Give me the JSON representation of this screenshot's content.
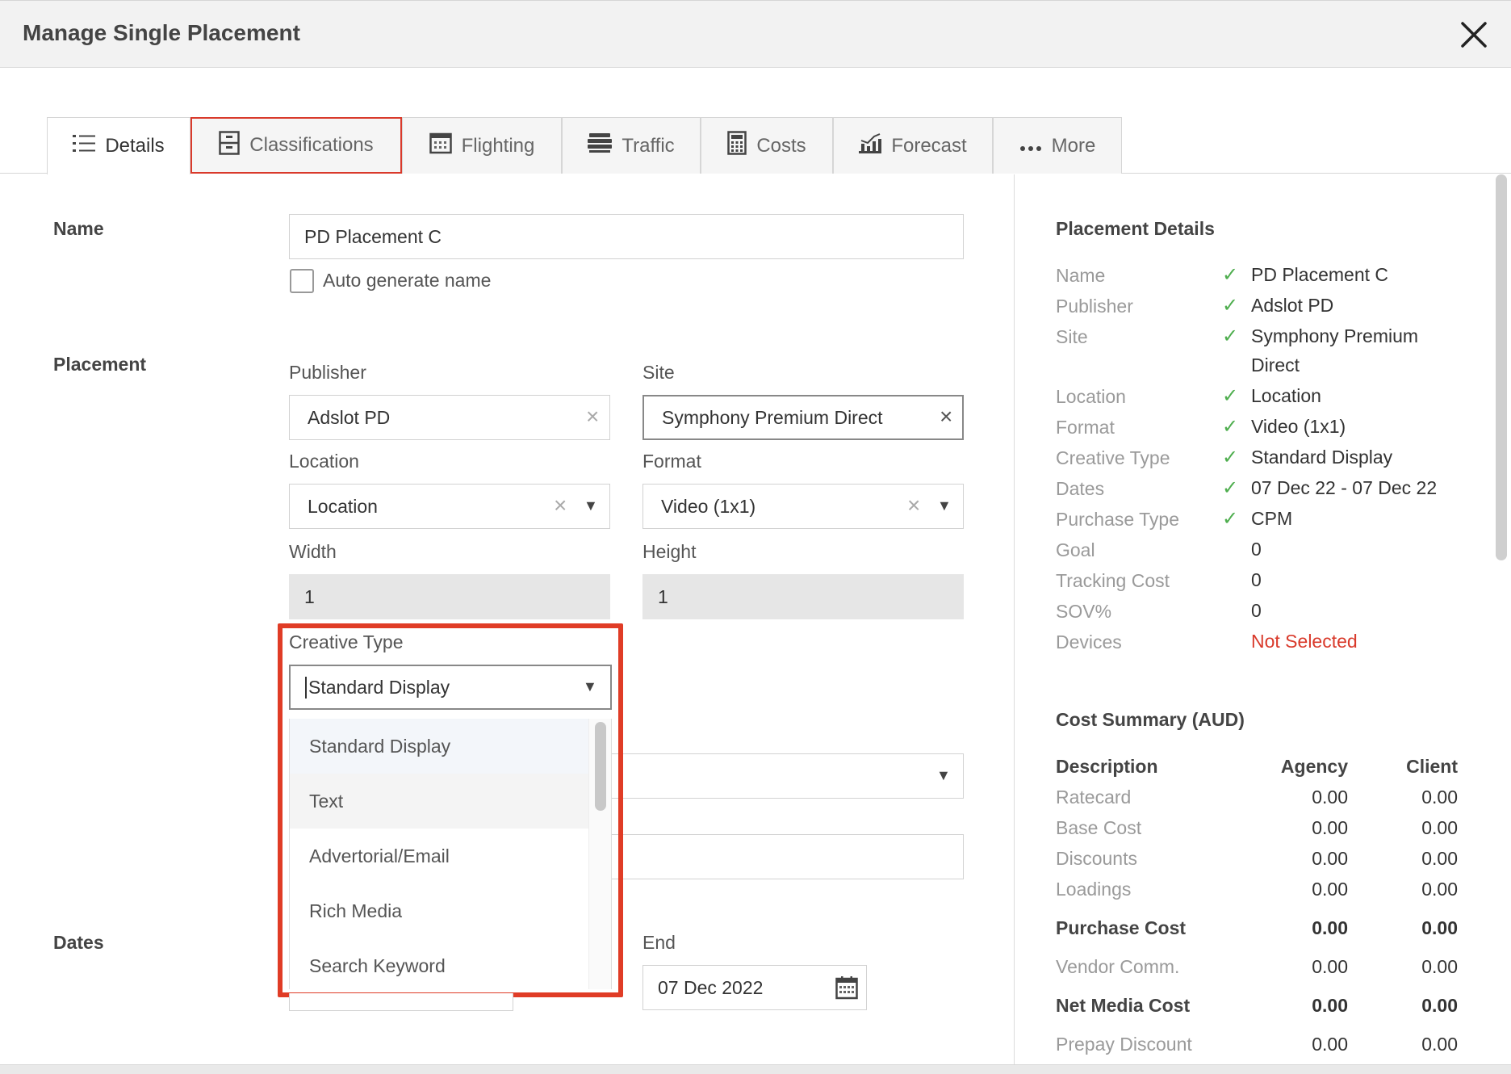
{
  "window": {
    "title": "Manage Single Placement"
  },
  "tabs": [
    {
      "label": "Details",
      "icon": "list-icon"
    },
    {
      "label": "Classifications",
      "icon": "cabinet-icon"
    },
    {
      "label": "Flighting",
      "icon": "calendar-icon"
    },
    {
      "label": "Traffic",
      "icon": "server-icon"
    },
    {
      "label": "Costs",
      "icon": "calculator-icon"
    },
    {
      "label": "Forecast",
      "icon": "chart-icon"
    },
    {
      "label": "More",
      "icon": "ellipsis-icon"
    }
  ],
  "form": {
    "name_section": "Name",
    "name_value": "PD Placement C",
    "auto_generate_label": "Auto generate name",
    "placement_section": "Placement",
    "publisher_label": "Publisher",
    "publisher_value": "Adslot PD",
    "site_label": "Site",
    "site_value": "Symphony Premium Direct",
    "location_label": "Location",
    "location_value": "Location",
    "format_label": "Format",
    "format_value": "Video (1x1)",
    "width_label": "Width",
    "width_value": "1",
    "height_label": "Height",
    "height_value": "1",
    "creative_type_label": "Creative Type",
    "creative_type_value": "Standard Display",
    "creative_type_options": [
      "Standard Display",
      "Text",
      "Advertorial/Email",
      "Rich Media",
      "Search Keyword"
    ],
    "dates_section": "Dates",
    "end_label": "End",
    "end_value": "07 Dec 2022"
  },
  "placement_details": {
    "title": "Placement Details",
    "rows": [
      {
        "label": "Name",
        "value": "PD Placement C",
        "check": "✓"
      },
      {
        "label": "Publisher",
        "value": "Adslot PD",
        "check": "✓"
      },
      {
        "label": "Site",
        "value": "Symphony Premium Direct",
        "check": "✓"
      },
      {
        "label": "Location",
        "value": "Location",
        "check": "✓"
      },
      {
        "label": "Format",
        "value": "Video (1x1)",
        "check": "✓"
      },
      {
        "label": "Creative Type",
        "value": "Standard Display",
        "check": "✓"
      },
      {
        "label": "Dates",
        "value": "07 Dec 22 - 07 Dec 22",
        "check": "✓"
      },
      {
        "label": "Purchase Type",
        "value": "CPM",
        "check": "✓"
      },
      {
        "label": "Goal",
        "value": "0",
        "check": ""
      },
      {
        "label": "Tracking Cost",
        "value": "0",
        "check": ""
      },
      {
        "label": "SOV%",
        "value": "0",
        "check": ""
      },
      {
        "label": "Devices",
        "value": "Not Selected",
        "check": ""
      }
    ]
  },
  "cost_summary": {
    "title": "Cost Summary (AUD)",
    "col_description": "Description",
    "col_agency": "Agency",
    "col_client": "Client",
    "rows": [
      {
        "label": "Ratecard",
        "agency": "0.00",
        "client": "0.00"
      },
      {
        "label": "Base Cost",
        "agency": "0.00",
        "client": "0.00"
      },
      {
        "label": "Discounts",
        "agency": "0.00",
        "client": "0.00"
      },
      {
        "label": "Loadings",
        "agency": "0.00",
        "client": "0.00"
      },
      {
        "label": "Purchase Cost",
        "agency": "0.00",
        "client": "0.00"
      },
      {
        "label": "Vendor Comm.",
        "agency": "0.00",
        "client": "0.00"
      },
      {
        "label": "Net Media Cost",
        "agency": "0.00",
        "client": "0.00"
      },
      {
        "label": "Prepay Discount",
        "agency": "0.00",
        "client": "0.00"
      }
    ]
  },
  "colors": {
    "accent_red": "#e03c26",
    "check_green": "#4fae4f",
    "error_red": "#d93a2b"
  }
}
